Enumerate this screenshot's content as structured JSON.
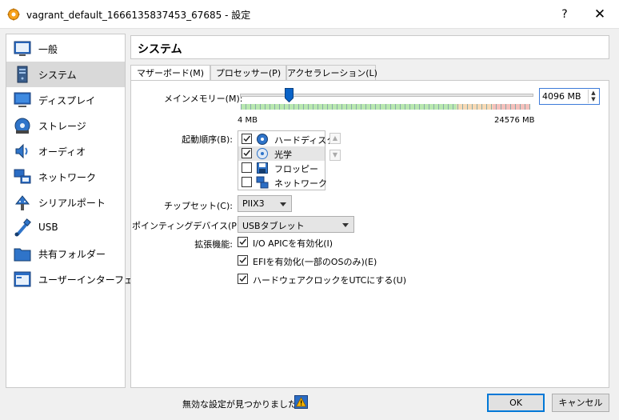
{
  "window": {
    "title": "vagrant_default_1666135837453_67685 - 設定",
    "help_label": "?",
    "close_label": "✕"
  },
  "sidebar": {
    "items": [
      {
        "label": "一般",
        "icon": "general-icon"
      },
      {
        "label": "システム",
        "icon": "system-icon",
        "active": true
      },
      {
        "label": "ディスプレイ",
        "icon": "display-icon"
      },
      {
        "label": "ストレージ",
        "icon": "storage-icon"
      },
      {
        "label": "オーディオ",
        "icon": "audio-icon"
      },
      {
        "label": "ネットワーク",
        "icon": "network-icon"
      },
      {
        "label": "シリアルポート",
        "icon": "serial-port-icon"
      },
      {
        "label": "USB",
        "icon": "usb-icon"
      },
      {
        "label": "共有フォルダー",
        "icon": "shared-folder-icon"
      },
      {
        "label": "ユーザーインターフェース",
        "icon": "user-interface-icon"
      }
    ]
  },
  "section": {
    "title": "システム"
  },
  "tabs": [
    {
      "label": "マザーボード(M)",
      "active": true
    },
    {
      "label": "プロセッサー(P)"
    },
    {
      "label": "アクセラレーション(L)"
    }
  ],
  "motherboard": {
    "memory": {
      "label": "メインメモリー(M):",
      "value": "4096 MB",
      "min_label": "4 MB",
      "max_label": "24576 MB",
      "fraction": 0.1665
    },
    "boot": {
      "label": "起動順序(B):",
      "items": [
        {
          "label": "ハードディスク",
          "checked": true,
          "icon": "hard-disk-icon"
        },
        {
          "label": "光学",
          "checked": true,
          "icon": "optical-disc-icon",
          "selected": true
        },
        {
          "label": "フロッピー",
          "checked": false,
          "icon": "floppy-icon"
        },
        {
          "label": "ネットワーク",
          "checked": false,
          "icon": "network-boot-icon"
        }
      ],
      "move_up": "▲",
      "move_down": "▼"
    },
    "chipset": {
      "label": "チップセット(C):",
      "value": "PIIX3"
    },
    "pointing": {
      "label": "ポインティングデバイス(P):",
      "value": "USBタブレット"
    },
    "features": {
      "label": "拡張機能:",
      "items": [
        {
          "label": "I/O APICを有効化(I)",
          "checked": true
        },
        {
          "label": "EFIを有効化(一部のOSのみ)(E)",
          "checked": true
        },
        {
          "label": "ハードウェアクロックをUTCにする(U)",
          "checked": true
        }
      ]
    }
  },
  "footer": {
    "message": "無効な設定が見つかりました",
    "ok_label": "OK",
    "cancel_label": "キャンセル"
  },
  "colors": {
    "slider_green": "#b9e8b0",
    "slider_orange": "#f7d9b5",
    "slider_red": "#f5c1bc",
    "accent": "#0078d7"
  }
}
